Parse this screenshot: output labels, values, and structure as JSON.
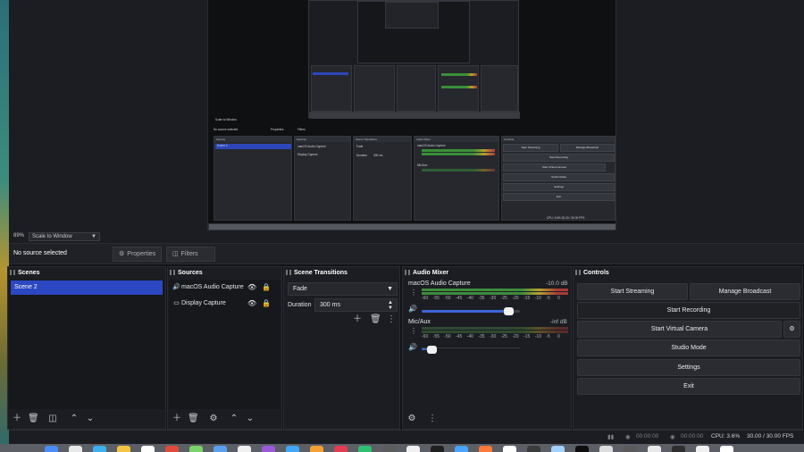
{
  "preview": {
    "zoom_percent": "89%",
    "zoom_mode": "Scale to Window",
    "mini": {
      "zoom_mode": "Scale to Window",
      "no_source": "No source selected",
      "properties": "Properties",
      "filters": "Filters",
      "scenes_title": "Scenes",
      "sources_title": "Sources",
      "transitions_title": "Scene Transitions",
      "mixer_title": "Audio Mixer",
      "controls_title": "Controls",
      "scene_item": "Scene 2",
      "source_1": "macOS Audio Capture",
      "source_2": "Display Capture",
      "fade": "Fade",
      "duration_label": "Duration",
      "duration_value": "300 ms",
      "mixer_1": "macOS Audio Capture",
      "mixer_2": "Mic/Aux",
      "btn_stream": "Start Streaming",
      "btn_manage": "Manage Broadcast",
      "btn_record": "Start Recording",
      "btn_vcam": "Start Virtual Camera",
      "btn_studio": "Studio Mode",
      "btn_settings": "Settings",
      "btn_exit": "Exit",
      "status": "CPU: 3.6%   30.00 / 30.00 FPS"
    }
  },
  "context": {
    "no_source": "No source selected",
    "properties": "Properties",
    "filters": "Filters"
  },
  "scenes": {
    "title": "Scenes",
    "items": [
      "Scene 2"
    ]
  },
  "sources": {
    "title": "Sources",
    "items": [
      {
        "label": "macOS Audio Capture",
        "icon": "speaker-icon"
      },
      {
        "label": "Display Capture",
        "icon": "monitor-icon"
      }
    ]
  },
  "transitions": {
    "title": "Scene Transitions",
    "type": "Fade",
    "duration_label": "Duration",
    "duration_value": "300 ms"
  },
  "mixer": {
    "title": "Audio Mixer",
    "ticks": [
      "-60",
      "-55",
      "-50",
      "-45",
      "-40",
      "-35",
      "-30",
      "-25",
      "-20",
      "-15",
      "-10",
      "-5",
      "0"
    ],
    "channels": [
      {
        "name": "macOS Audio Capture",
        "db": "-10.0 dB",
        "volume": 0.93
      },
      {
        "name": "Mic/Aux",
        "db": "-inf dB",
        "volume": 0.06
      }
    ]
  },
  "controls": {
    "title": "Controls",
    "start_streaming": "Start Streaming",
    "manage_broadcast": "Manage Broadcast",
    "start_recording": "Start Recording",
    "start_virtual_camera": "Start Virtual Camera",
    "studio_mode": "Studio Mode",
    "settings": "Settings",
    "exit": "Exit"
  },
  "status": {
    "rec_time_1": "00:00:00",
    "rec_time_2": "00:00:00",
    "cpu": "CPU: 3.6%",
    "fps": "30.00 / 30.00 FPS"
  },
  "colors": {
    "accent": "#2b47c2",
    "background": "#1b1d22",
    "meter_green": "#3e8c3e",
    "meter_yellow": "#b5a130",
    "meter_red": "#a83a3a"
  }
}
